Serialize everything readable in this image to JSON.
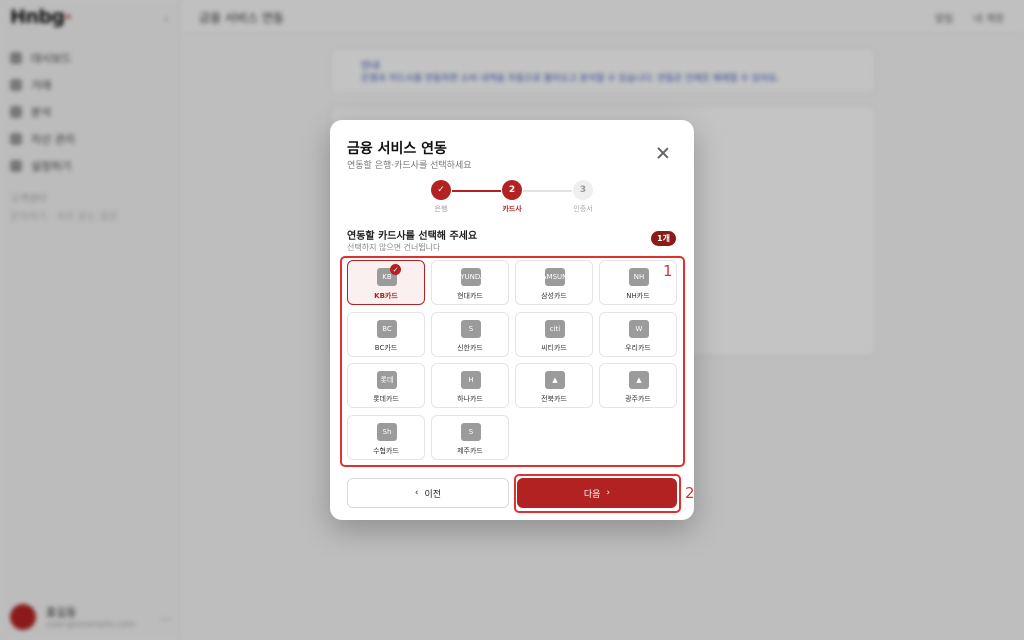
{
  "background": {
    "logo": "Hnbg",
    "nav_items": [
      "대시보드",
      "거래",
      "분석",
      "자산 관리",
      "설정하기"
    ],
    "section_label": "고객센터",
    "section_sub": "문의하기 · 자주 묻는 질문",
    "page_title": "금융 서비스 연동",
    "top_actions": [
      "알림",
      "내 계정"
    ],
    "notice_title": "안내",
    "notice_text": "은행과 카드사를 연동하면 소비 내역을 자동으로 불러오고 분석할 수 있습니다. 연동은 언제든 해제할 수 있어요.",
    "user_name": "홍길동",
    "user_mail": "user@example.com"
  },
  "modal": {
    "title": "금융 서비스 연동",
    "subtitle": "연동할 은행·카드사를 선택하세요",
    "steps": [
      {
        "label": "은행",
        "state": "done",
        "number": "1"
      },
      {
        "label": "카드사",
        "state": "active",
        "number": "2"
      },
      {
        "label": "인증서",
        "state": "todo",
        "number": "3"
      }
    ],
    "section_title": "연동할 카드사를 선택해 주세요",
    "section_sub": "선택하지 않으면 건너뜁니다",
    "selected_count": "1개",
    "cards": [
      {
        "name": "KB카드",
        "logo": "KB",
        "selected": true
      },
      {
        "name": "현대카드",
        "logo": "HYUNDAI",
        "selected": false
      },
      {
        "name": "삼성카드",
        "logo": "SAMSUNG",
        "selected": false
      },
      {
        "name": "NH카드",
        "logo": "NH",
        "selected": false
      },
      {
        "name": "BC카드",
        "logo": "BC",
        "selected": false
      },
      {
        "name": "신한카드",
        "logo": "S",
        "selected": false
      },
      {
        "name": "씨티카드",
        "logo": "citi",
        "selected": false
      },
      {
        "name": "우리카드",
        "logo": "W",
        "selected": false
      },
      {
        "name": "롯데카드",
        "logo": "롯데",
        "selected": false
      },
      {
        "name": "하나카드",
        "logo": "H",
        "selected": false
      },
      {
        "name": "전북카드",
        "logo": "▲",
        "selected": false
      },
      {
        "name": "광주카드",
        "logo": "▲",
        "selected": false
      },
      {
        "name": "수협카드",
        "logo": "Sh",
        "selected": false
      },
      {
        "name": "제주카드",
        "logo": "S",
        "selected": false
      }
    ],
    "prev_label": "이전",
    "next_label": "다음"
  },
  "annotations": {
    "label_1": "1",
    "label_2": "2"
  },
  "colors": {
    "accent": "#b22222",
    "annotation": "#e0312f"
  }
}
